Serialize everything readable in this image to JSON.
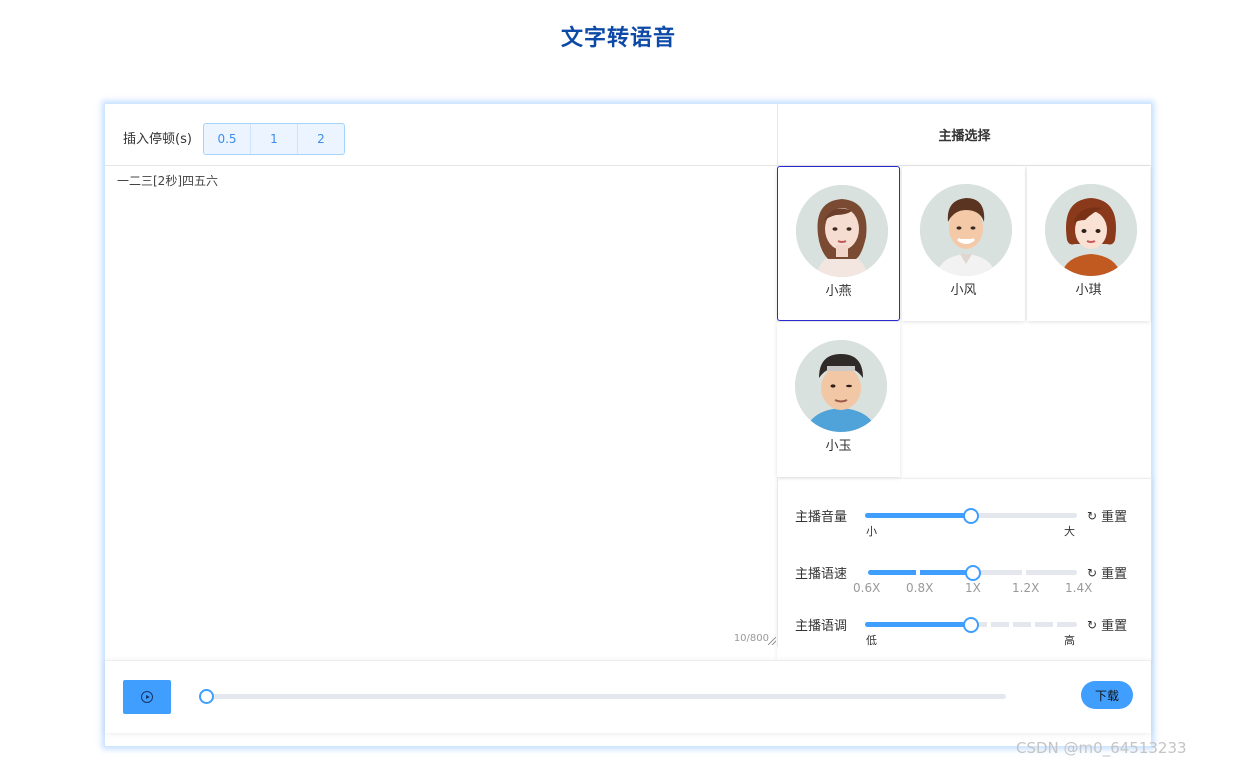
{
  "page": {
    "title": "文字转语音"
  },
  "pause": {
    "label": "插入停顿(s)",
    "options": [
      "0.5",
      "1",
      "2"
    ]
  },
  "editor": {
    "text": "一二三[2秒]四五六",
    "counter": "10/800"
  },
  "anchors": {
    "header": "主播选择",
    "selected": "小燕",
    "items": [
      {
        "name": "小燕",
        "icon": "female-avatar-icon"
      },
      {
        "name": "小风",
        "icon": "male-avatar-icon"
      },
      {
        "name": "小琪",
        "icon": "female-avatar-icon"
      },
      {
        "name": "小玉",
        "icon": "male-avatar-icon"
      }
    ]
  },
  "controls": {
    "reset_label": "重置",
    "volume": {
      "label": "主播音量",
      "min_label": "小",
      "max_label": "大",
      "value": 0.5
    },
    "speed": {
      "label": "主播语速",
      "marks": [
        "0.6X",
        "0.8X",
        "1X",
        "1.2X",
        "1.4X"
      ],
      "value": "1X"
    },
    "tone": {
      "label": "主播语调",
      "min_label": "低",
      "max_label": "高",
      "value": 0.5
    }
  },
  "player": {
    "download_label": "下载",
    "progress": 0
  },
  "watermark": "CSDN @m0_64513233",
  "colors": {
    "accent": "#409eff",
    "title": "#0d4aa8",
    "selected_border": "#2b2bd6"
  }
}
